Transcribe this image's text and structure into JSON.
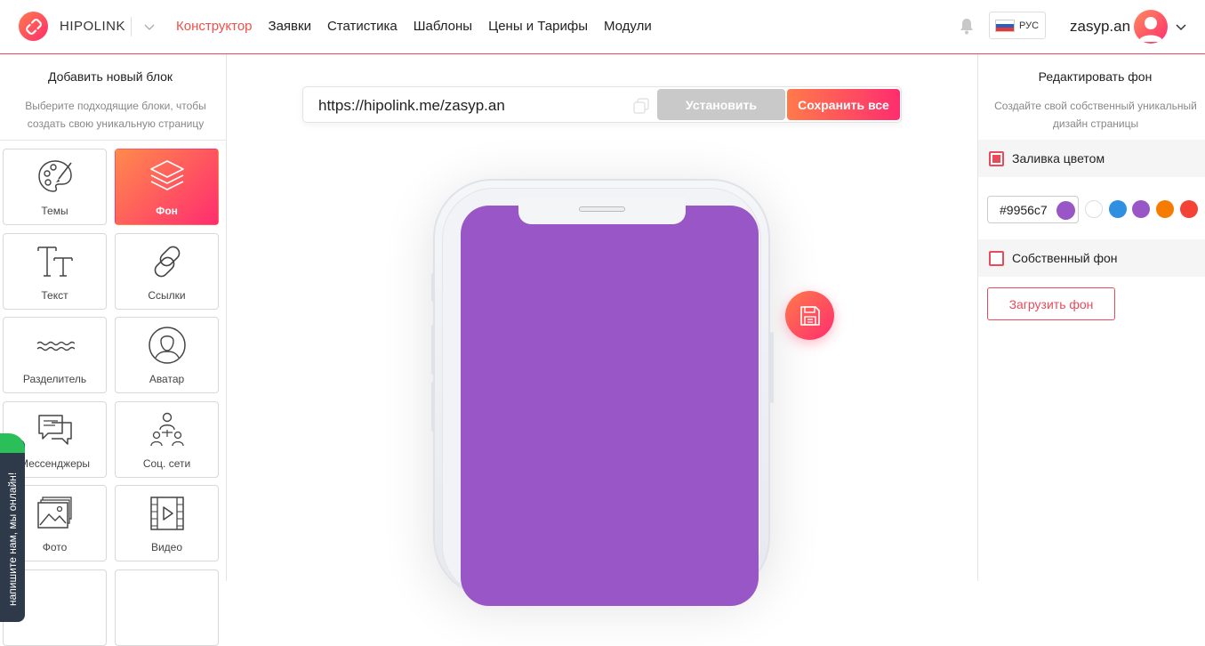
{
  "header": {
    "brand": "HIPOLINK",
    "nav": [
      {
        "label": "Конструктор",
        "active": true
      },
      {
        "label": "Заявки",
        "active": false
      },
      {
        "label": "Статистика",
        "active": false
      },
      {
        "label": "Шаблоны",
        "active": false
      },
      {
        "label": "Цены и Тарифы",
        "active": false
      },
      {
        "label": "Модули",
        "active": false
      }
    ],
    "language": "РУС",
    "username": "zasyp.an"
  },
  "left_panel": {
    "title": "Добавить новый блок",
    "subtitle": "Выберите подходящие блоки, чтобы создать свою уникальную страницу",
    "tiles": [
      {
        "label": "Темы",
        "icon": "palette-icon"
      },
      {
        "label": "Фон",
        "icon": "layers-icon"
      },
      {
        "label": "Текст",
        "icon": "text-icon"
      },
      {
        "label": "Ссылки",
        "icon": "link-icon"
      },
      {
        "label": "Разделитель",
        "icon": "wave-divider-icon"
      },
      {
        "label": "Аватар",
        "icon": "avatar-icon"
      },
      {
        "label": "Мессенджеры",
        "icon": "chat-bubbles-icon"
      },
      {
        "label": "Соц. сети",
        "icon": "people-network-icon"
      },
      {
        "label": "Фото",
        "icon": "photo-icon"
      },
      {
        "label": "Видео",
        "icon": "video-icon"
      }
    ],
    "online_chat": "напишите нам, мы онлайн!"
  },
  "center": {
    "url": "https://hipolink.me/zasyp.an",
    "install_label": "Установить",
    "save_all_label": "Сохранить все",
    "screen_color": "#9956c7"
  },
  "right_panel": {
    "title": "Редактировать фон",
    "subtitle": "Создайте свой собственный уникальный дизайн страницы",
    "color_fill_label": "Заливка цветом",
    "color_fill_checked": true,
    "color_value": "#9956c7",
    "swatches": [
      "#ffffff",
      "#2f8fe0",
      "#9956c7",
      "#f57c00",
      "#f44336"
    ],
    "own_bg_label": "Собственный фон",
    "own_bg_checked": false,
    "upload_label": "Загрузить фон"
  },
  "colors": {
    "accent": "#f0504a",
    "gradient_start": "#ff7a4a",
    "gradient_end": "#ff2d6f"
  }
}
